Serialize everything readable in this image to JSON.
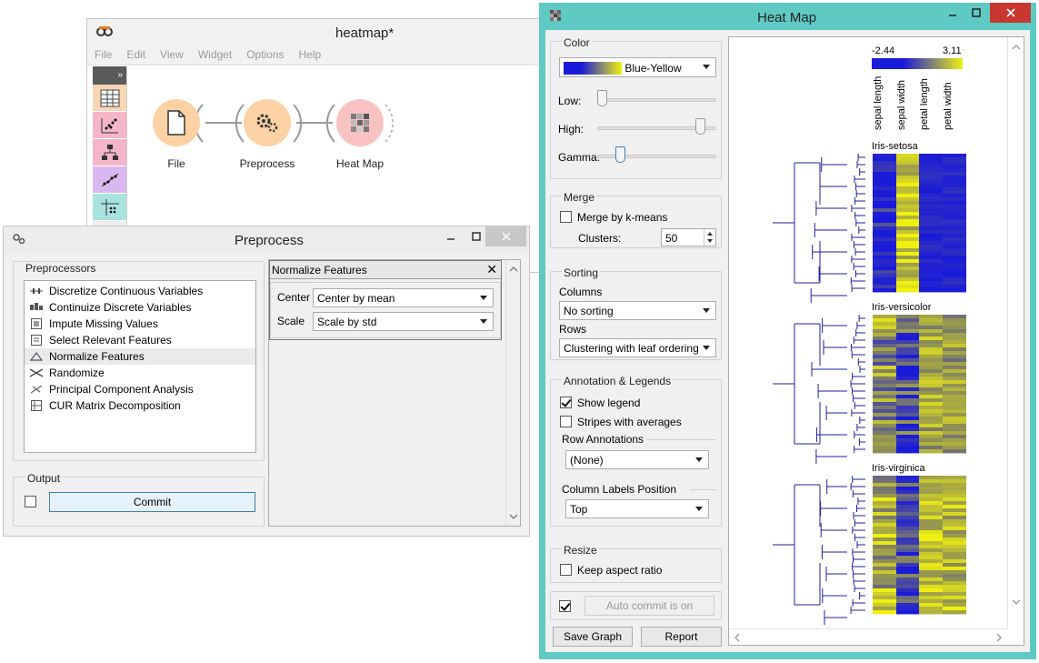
{
  "canvas": {
    "title": "heatmap*",
    "menu": [
      "File",
      "Edit",
      "View",
      "Widget",
      "Options",
      "Help"
    ],
    "toolbox_toggle": "»",
    "toolbox_colors": [
      "#f8d5b5",
      "#f4b6c8",
      "#f4b6c8",
      "#d9b8f0",
      "#a9e3e0"
    ],
    "nodes": [
      {
        "label": "File",
        "color": "#fcd2a5",
        "icon": "file-icon"
      },
      {
        "label": "Preprocess",
        "color": "#fcd2a5",
        "icon": "gears-icon"
      },
      {
        "label": "Heat Map",
        "color": "#f9c2c2",
        "icon": "heatmap-icon"
      }
    ]
  },
  "preprocess": {
    "title": "Preprocess",
    "preprocessors_label": "Preprocessors",
    "items": [
      {
        "label": "Discretize Continuous Variables",
        "icon": "discretize-icon"
      },
      {
        "label": "Continuize Discrete Variables",
        "icon": "continuize-icon"
      },
      {
        "label": "Impute Missing Values",
        "icon": "impute-icon"
      },
      {
        "label": "Select Relevant Features",
        "icon": "select-features-icon"
      },
      {
        "label": "Normalize Features",
        "icon": "normalize-icon",
        "selected": true
      },
      {
        "label": "Randomize",
        "icon": "randomize-icon"
      },
      {
        "label": "Principal Component Analysis",
        "icon": "pca-icon"
      },
      {
        "label": "CUR Matrix Decomposition",
        "icon": "cur-icon"
      }
    ],
    "output_label": "Output",
    "commit_label": "Commit",
    "panel": {
      "title": "Normalize Features",
      "center_label": "Center",
      "center_value": "Center by mean",
      "scale_label": "Scale",
      "scale_value": "Scale by std"
    }
  },
  "heatmap": {
    "title": "Heat Map",
    "color": {
      "group": "Color",
      "palette": "Blue-Yellow",
      "low_label": "Low:",
      "high_label": "High:",
      "gamma_label": "Gamma:",
      "low_value": 0.0,
      "high_value": 0.9,
      "gamma_value": 0.17
    },
    "merge": {
      "group": "Merge",
      "kmeans_label": "Merge by k-means",
      "clusters_label": "Clusters:",
      "clusters_value": "50"
    },
    "sorting": {
      "group": "Sorting",
      "columns_label": "Columns",
      "columns_value": "No sorting",
      "rows_label": "Rows",
      "rows_value": "Clustering with leaf ordering"
    },
    "annotation": {
      "group": "Annotation & Legends",
      "show_legend_label": "Show legend",
      "stripes_label": "Stripes with averages",
      "row_annotations_label": "Row Annotations",
      "row_annotations_value": "(None)",
      "col_labels_pos_label": "Column Labels Position",
      "col_labels_pos_value": "Top"
    },
    "resize": {
      "group": "Resize",
      "keep_aspect_label": "Keep aspect ratio"
    },
    "auto_commit_label": "Auto commit is on",
    "save_graph_label": "Save Graph",
    "report_label": "Report",
    "legend": {
      "min": "-2.44",
      "max": "3.11"
    },
    "columns": [
      "sepal length",
      "sepal width",
      "petal length",
      "petal width"
    ],
    "groups": [
      "Iris-setosa",
      "Iris-versicolor",
      "Iris-virginica"
    ],
    "colors": {
      "low": "#1a1ad9",
      "mid": "#8a8a5a",
      "high": "#f0f010",
      "accent": "#5fc9c4"
    }
  }
}
